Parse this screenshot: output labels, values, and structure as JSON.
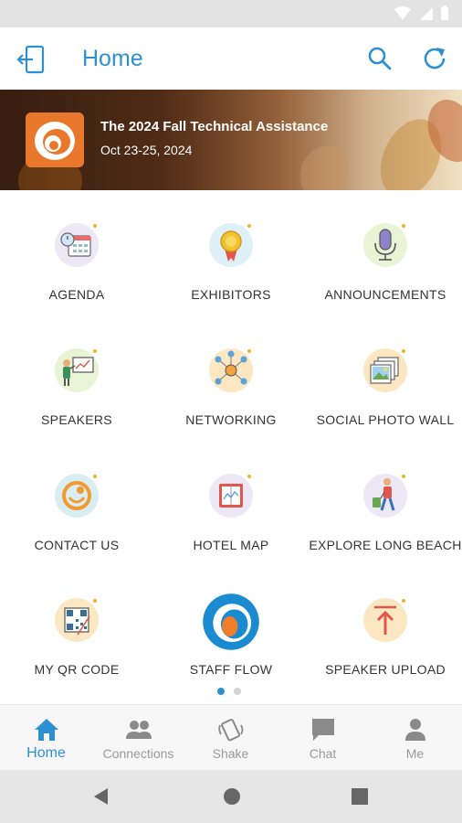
{
  "app": {
    "title": "Home"
  },
  "event": {
    "title": "The 2024 Fall Technical Assistance",
    "dates": "Oct 23-25, 2024"
  },
  "tiles": [
    {
      "label": "AGENDA",
      "icon": "agenda-calendar-icon"
    },
    {
      "label": "EXHIBITORS",
      "icon": "award-ribbon-icon"
    },
    {
      "label": "ANNOUNCEMENTS",
      "icon": "microphone-icon"
    },
    {
      "label": "SPEAKERS",
      "icon": "presenter-board-icon"
    },
    {
      "label": "NETWORKING",
      "icon": "network-people-icon"
    },
    {
      "label": "SOCIAL PHOTO WALL",
      "icon": "photo-stack-icon"
    },
    {
      "label": "CONTACT US",
      "icon": "contact-headset-icon"
    },
    {
      "label": "HOTEL MAP",
      "icon": "map-book-icon"
    },
    {
      "label": "EXPLORE LONG BEACH",
      "icon": "traveler-luggage-icon"
    },
    {
      "label": "MY QR CODE",
      "icon": "qr-code-icon"
    },
    {
      "label": "STAFF FLOW",
      "icon": "staff-flow-logo-icon"
    },
    {
      "label": "SPEAKER UPLOAD",
      "icon": "upload-arrow-icon"
    }
  ],
  "pager": {
    "pages": 2,
    "current": 1
  },
  "nav": [
    {
      "label": "Home",
      "icon": "home-icon",
      "active": true
    },
    {
      "label": "Connections",
      "icon": "people-icon",
      "active": false
    },
    {
      "label": "Shake",
      "icon": "shake-phone-icon",
      "active": false
    },
    {
      "label": "Chat",
      "icon": "chat-bubble-icon",
      "active": false
    },
    {
      "label": "Me",
      "icon": "person-icon",
      "active": false
    }
  ],
  "colors": {
    "accent": "#2e90d0",
    "inactive": "#9a9a9a",
    "statusBar": "#e3e3e3"
  }
}
